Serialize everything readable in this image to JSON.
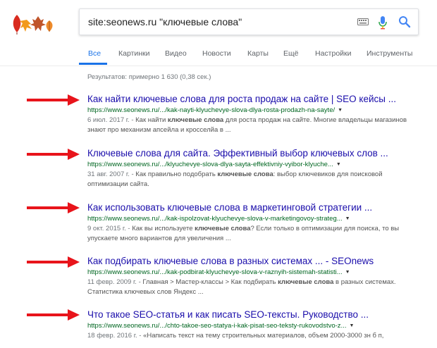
{
  "logo": {
    "name": "autumn-leaves-doodle"
  },
  "search": {
    "query": "site:seonews.ru \"ключевые слова\"",
    "keyboard_icon": "keyboard-icon",
    "mic_icon": "microphone-icon",
    "search_icon": "search-icon"
  },
  "tabs": [
    {
      "label": "Все",
      "active": true
    },
    {
      "label": "Картинки"
    },
    {
      "label": "Видео"
    },
    {
      "label": "Новости"
    },
    {
      "label": "Карты"
    },
    {
      "label": "Ещё"
    },
    {
      "label": "Настройки"
    },
    {
      "label": "Инструменты"
    }
  ],
  "result_stats": "Результатов: примерно 1 630 (0,38 сек.)",
  "results": [
    {
      "title": "Как найти ключевые слова для роста продаж на сайте | SEO кейсы ...",
      "url": "https://www.seonews.ru/.../kak-nayti-klyuchevye-slova-dlya-rosta-prodazh-na-sayte/",
      "date": "6 июл. 2017 г. - ",
      "snippet_pre": "Как найти ",
      "snippet_bold": "ключевые слова",
      "snippet_post": " для роста продаж на сайте. Многие владельцы магазинов знают про механизм апсейла и кросселйа в ..."
    },
    {
      "title": "Ключевые слова для сайта. Эффективный выбор ключевых слов ...",
      "url": "https://www.seonews.ru/.../klyuchevye-slova-dlya-sayta-effektivniy-vyibor-klyuche...",
      "date": "31 авг. 2007 г. - ",
      "snippet_pre": "Как правильно подобрать ",
      "snippet_bold": "ключевые слова",
      "snippet_post": ": выбор ключевиков для поисковой оптимизации сайта."
    },
    {
      "title": "Как использовать ключевые слова в маркетинговой стратегии ...",
      "url": "https://www.seonews.ru/.../kak-ispolzovat-klyuchevye-slova-v-marketingovoy-strateg...",
      "date": "9 окт. 2015 г. - ",
      "snippet_pre": "Как вы используете ",
      "snippet_bold": "ключевые слова",
      "snippet_post": "? Если только в оптимизации для поиска, то вы упускаете много вариантов для увеличения ..."
    },
    {
      "title": "Как подбирать ключевые слова в разных системах ... - SEOnews",
      "url": "https://www.seonews.ru/.../kak-podbirat-klyuchevye-slova-v-raznyih-sistemah-statisti...",
      "date": "11 февр. 2009 г. - ",
      "snippet_pre": "Главная > Мастер-классы > Как подбирать ",
      "snippet_bold": "ключевые слова",
      "snippet_post": " в разных системах. Статистика ключевых слов Яндекс ..."
    },
    {
      "title": "Что такое SEO-статья и как писать SEO-тексты. Руководство ...",
      "url": "https://www.seonews.ru/.../chto-takoe-seo-statya-i-kak-pisat-seo-teksty-rukovodstvo-z...",
      "date": "18 февр. 2016 г. - ",
      "snippet_pre": "«Написать текст на тему строительных материалов, объем 2000-3000 зн б п,",
      "snippet_bold": "",
      "snippet_post": ""
    }
  ],
  "colors": {
    "title_link": "#1a0dab",
    "url_green": "#006621",
    "accent_blue": "#1a73e8",
    "arrow_red": "#e8141b"
  }
}
